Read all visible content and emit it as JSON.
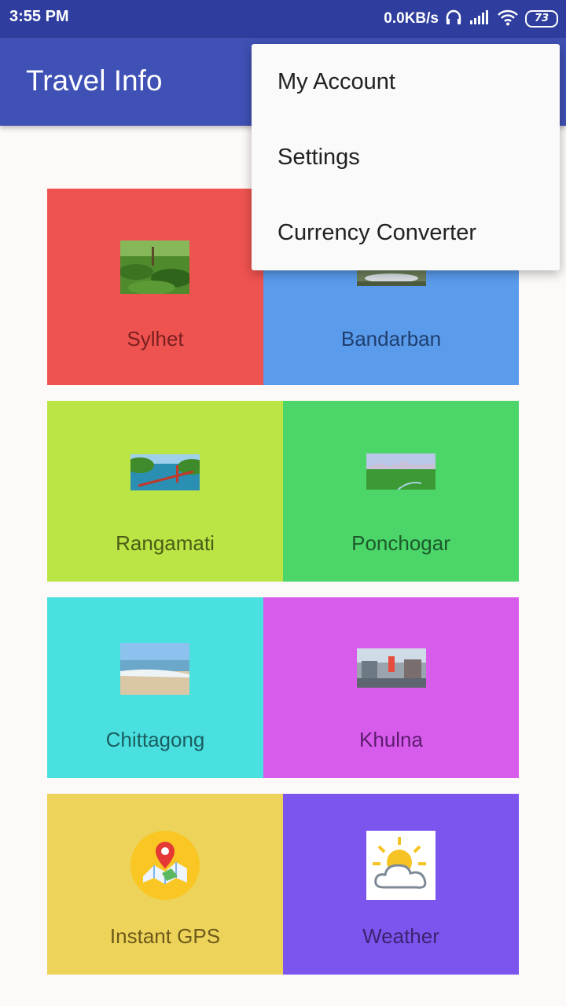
{
  "status_bar": {
    "time": "3:55 PM",
    "net_speed": "0.0KB/s",
    "battery": "73"
  },
  "app_bar": {
    "title": "Travel Info"
  },
  "tiles": [
    {
      "label": "Sylhet",
      "color": "#ef5350"
    },
    {
      "label": "Bandarban",
      "color": "#5a9bec"
    },
    {
      "label": "Rangamati",
      "color": "#bbe445"
    },
    {
      "label": "Ponchogar",
      "color": "#4cd66a"
    },
    {
      "label": "Chittagong",
      "color": "#4ae0e0"
    },
    {
      "label": "Khulna",
      "color": "#d85cec"
    },
    {
      "label": "Instant GPS",
      "color": "#edd35a"
    },
    {
      "label": "Weather",
      "color": "#7c55ef"
    }
  ],
  "overflow_menu": {
    "items": [
      "My Account",
      "Settings",
      "Currency Converter"
    ]
  }
}
